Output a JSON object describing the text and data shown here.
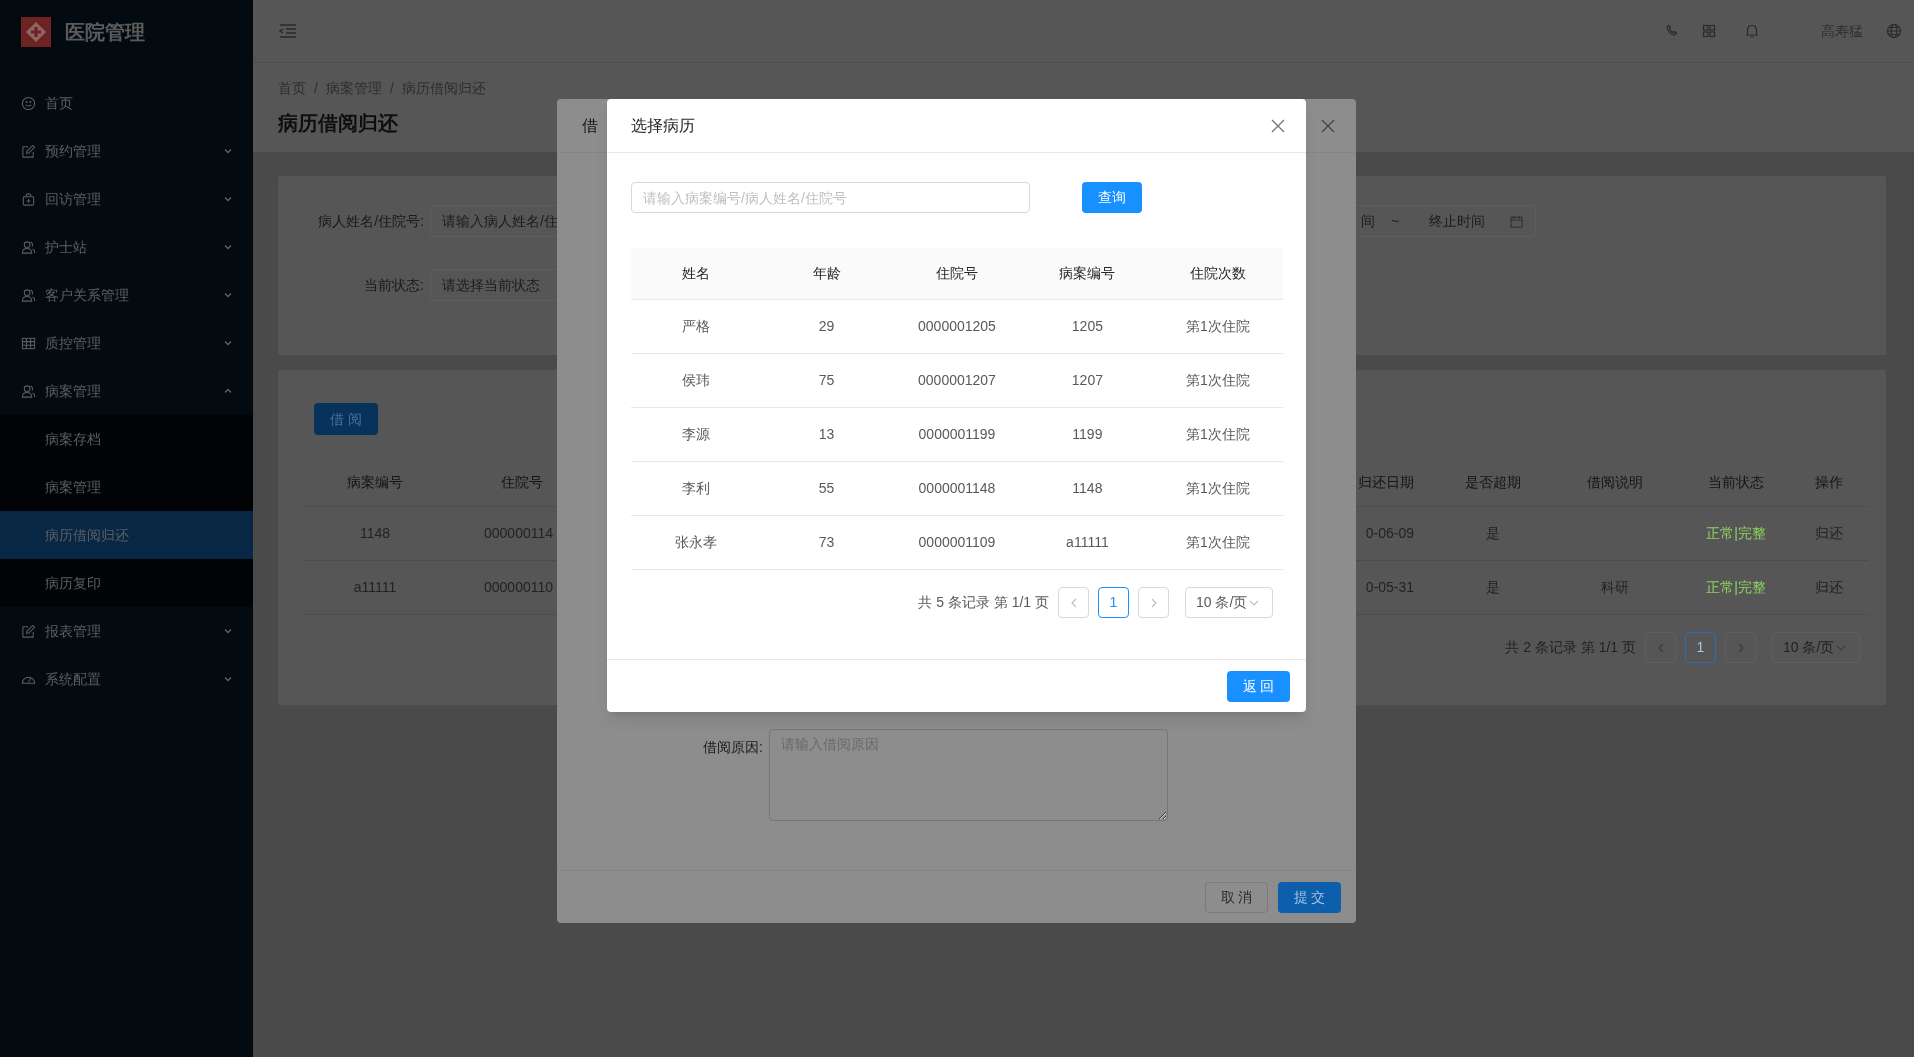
{
  "sidebar": {
    "title": "医院管理",
    "items": [
      {
        "label": "首页"
      },
      {
        "label": "预约管理",
        "expanded": false
      },
      {
        "label": "回访管理",
        "expanded": false
      },
      {
        "label": "护士站",
        "expanded": false
      },
      {
        "label": "客户关系管理",
        "expanded": false
      },
      {
        "label": "质控管理",
        "expanded": false
      },
      {
        "label": "病案管理",
        "expanded": true,
        "children": [
          {
            "label": "病案存档",
            "selected": false
          },
          {
            "label": "病案管理",
            "selected": false
          },
          {
            "label": "病历借阅归还",
            "selected": true
          },
          {
            "label": "病历复印",
            "selected": false
          }
        ]
      },
      {
        "label": "报表管理",
        "expanded": false
      },
      {
        "label": "系统配置",
        "expanded": false
      }
    ]
  },
  "header": {
    "user_name": "高寿猛"
  },
  "breadcrumb": {
    "separator": "/",
    "items": [
      "首页",
      "病案管理",
      "病历借阅归还"
    ]
  },
  "page_title": "病历借阅归还",
  "search_form": {
    "fields": [
      {
        "label": "病人姓名/住院号:",
        "placeholder": "请输入病人姓名/住"
      },
      {
        "label": "当前状态:",
        "placeholder": "请选择当前状态"
      }
    ],
    "date_range": {
      "start_placeholder": "间",
      "separator": "~",
      "end_placeholder": "终止时间"
    }
  },
  "records": {
    "borrow_button": "借 阅",
    "left_columns": [
      "病案编号",
      "住院号"
    ],
    "right_columns": [
      "归还日期",
      "是否超期",
      "借阅说明",
      "当前状态",
      "操作"
    ],
    "rows": [
      {
        "case_no": "1148",
        "admission_no": "000000114",
        "return_date": "0-06-09",
        "overdue": "是",
        "status": "正常|完整",
        "action": "归还"
      },
      {
        "case_no": "a11111",
        "admission_no": "000000110",
        "return_date": "0-05-31",
        "overdue": "是",
        "note": "科研",
        "status": "正常|完整",
        "action": "归还"
      }
    ],
    "pagination": {
      "summary": "共 2 条记录 第 1/1 页",
      "pages": [
        {
          "label": "1",
          "selected": true
        }
      ],
      "page_size": "10 条/页"
    }
  },
  "borrow_dialog": {
    "title": "借",
    "reason_label": "借阅原因:",
    "reason_placeholder": "请输入借阅原因",
    "buttons": [
      "取 消",
      "提 交"
    ]
  },
  "select_dialog": {
    "title": "选择病历",
    "search_placeholder": "请输入病案编号/病人姓名/住院号",
    "search_button": "查询",
    "columns": [
      "姓名",
      "年龄",
      "住院号",
      "病案编号",
      "住院次数"
    ],
    "rows": [
      [
        "严格",
        "29",
        "0000001205",
        "1205",
        "第1次住院"
      ],
      [
        "侯玮",
        "75",
        "0000001207",
        "1207",
        "第1次住院"
      ],
      [
        "李源",
        "13",
        "0000001199",
        "1199",
        "第1次住院"
      ],
      [
        "李利",
        "55",
        "0000001148",
        "1148",
        "第1次住院"
      ],
      [
        "张永孝",
        "73",
        "0000001109",
        "a11111",
        "第1次住院"
      ]
    ],
    "pagination": {
      "summary": "共 5 条记录 第 1/1 页",
      "pages": [
        {
          "label": "1",
          "selected": true
        }
      ],
      "page_size": "10 条/页"
    },
    "footer_button": "返 回"
  }
}
